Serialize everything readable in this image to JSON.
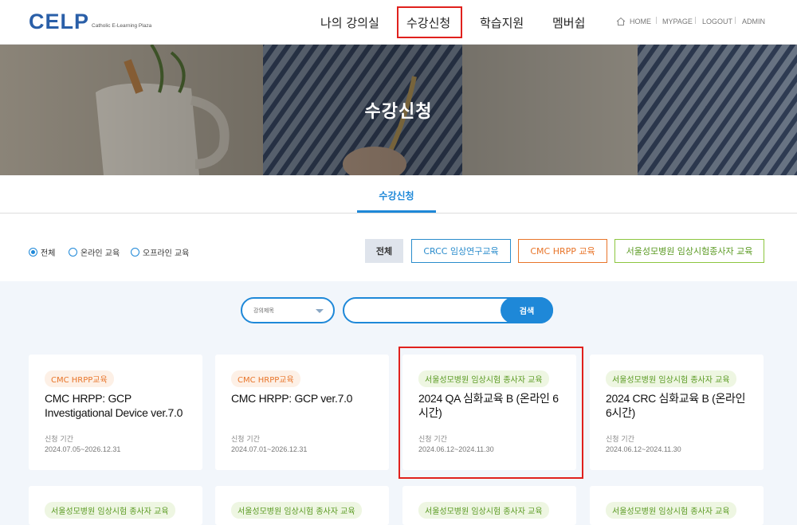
{
  "header": {
    "logo_text_ce": "CE",
    "logo_text_lp": "LP",
    "logo_subtitle": "Catholic E-Learning Plaza",
    "gnb": [
      "나의 강의실",
      "수강신청",
      "학습지원",
      "멤버쉽"
    ],
    "util": [
      "HOME",
      "MYPAGE",
      "LOGOUT",
      "ADMIN"
    ]
  },
  "hero": {
    "title": "수강신청"
  },
  "subnav": {
    "active_tab": "수강신청"
  },
  "filters": {
    "radios": [
      {
        "label": "전체",
        "checked": true
      },
      {
        "label": "온라인 교육",
        "checked": false
      },
      {
        "label": "오프라인 교육",
        "checked": false
      }
    ],
    "categories": [
      "전체",
      "CRCC 임상연구교육",
      "CMC HRPP 교육",
      "서울성모병원 임상시험종사자 교육"
    ]
  },
  "search": {
    "select_label": "강의제목",
    "input_value": "",
    "button_label": "검색"
  },
  "period_label": "신청 기간",
  "courses": [
    {
      "tag": "CMC HRPP교육",
      "title": "CMC HRPP: GCP Investigational Device ver.7.0",
      "period": "2024.07.05~2026.12.31"
    },
    {
      "tag": "CMC HRPP교육",
      "title": "CMC HRPP: GCP ver.7.0",
      "period": "2024.07.01~2026.12.31"
    },
    {
      "tag": "서울성모병원 임상시험 종사자 교육",
      "title": "2024 QA 심화교육 B (온라인 6시간)",
      "period": "2024.06.12~2024.11.30"
    },
    {
      "tag": "서울성모병원 임상시험 종사자 교육",
      "title": "2024 CRC 심화교육 B (온라인 6시간)",
      "period": "2024.06.12~2024.11.30"
    },
    {
      "tag": "서울성모병원 임상시험 종사자 교육",
      "title": "",
      "period": ""
    },
    {
      "tag": "서울성모병원 임상시험 종사자 교육",
      "title": "",
      "period": ""
    },
    {
      "tag": "서울성모병원 임상시험 종사자 교육",
      "title": "",
      "period": ""
    },
    {
      "tag": "서울성모병원 임상시험 종사자 교육",
      "title": "",
      "period": ""
    }
  ],
  "colors": {
    "accent": "#1e88d8",
    "orange": "#e8752a",
    "green": "#5a9a22",
    "highlight": "#e0211d"
  }
}
